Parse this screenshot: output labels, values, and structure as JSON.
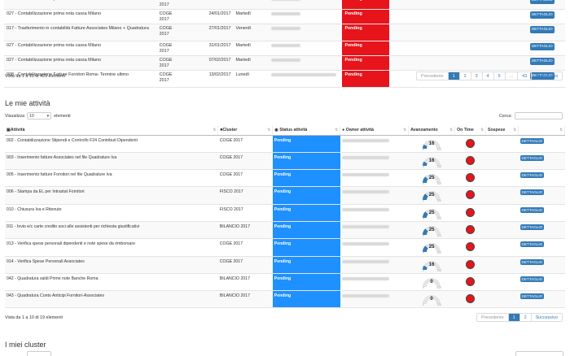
{
  "top_table": {
    "rows": [
      {
        "activity": "027 - Contabilizzazione prima nota cassa Milano",
        "cluster": "COGE 2017",
        "date": "17/01/2017",
        "day": "Martedì",
        "status": "Pending",
        "action": "DETTAGLIO"
      },
      {
        "activity": "027 - Contabilizzazione prima nota cassa Milano",
        "cluster": "COGE 2017",
        "date": "24/01/2017",
        "day": "Martedì",
        "status": "Pending",
        "action": "DETTAGLIO"
      },
      {
        "activity": "017 - Trasferimento in contabilità Fatture Associates Milano + Quadratura",
        "cluster": "COGE 2017",
        "date": "27/01/2017",
        "day": "Venerdì",
        "status": "Pending",
        "action": "DETTAGLIO"
      },
      {
        "activity": "027 - Contabilizzazione prima nota cassa Milano",
        "cluster": "COGE 2017",
        "date": "31/01/2017",
        "day": "Martedì",
        "status": "Pending",
        "action": "DETTAGLIO"
      },
      {
        "activity": "027 - Contabilizzazione prima nota cassa Milano",
        "cluster": "COGE 2017",
        "date": "07/02/2017",
        "day": "Martedì",
        "status": "Pending",
        "action": "DETTAGLIO"
      },
      {
        "activity": "008 - Contabilizzazione Fatture Fornitori Roma- Termine ultimo",
        "cluster": "COGE 2017",
        "date": "13/02/2017",
        "day": "Lunedì",
        "status": "Pending",
        "action": "DETTAGLIO"
      }
    ],
    "info": "Vista da 1 a 10 di 429 elementi",
    "pager": [
      "Precedente",
      "1",
      "2",
      "3",
      "4",
      "5",
      "...",
      "43",
      "Successivo"
    ]
  },
  "activities": {
    "title": "Le mie attività",
    "show_label": "Visualizza",
    "show_value": "10",
    "elements_label": "elementi",
    "search_label": "Cerca:",
    "columns": [
      "Attività",
      "Cluster",
      "Status attività",
      "Owner attività",
      "Avanzamento",
      "On Time",
      "Sospese",
      ""
    ],
    "rows": [
      {
        "activity": "002 - Contabilizzazione Stipendi e Controllo F24 Contributi Dipendenti",
        "cluster": "COGE 2017",
        "status": "Pending",
        "progress": "16",
        "action": "DETTAGLIO"
      },
      {
        "activity": "003 - Inserimento fatture Associates nel file Quadrature Iva",
        "cluster": "COGE 2017",
        "status": "Pending",
        "progress": "16",
        "action": "DETTAGLIO"
      },
      {
        "activity": "005 - Inserimento fatture Fornitori nel file Quadrature Iva",
        "cluster": "COGE 2017",
        "status": "Pending",
        "progress": "25",
        "action": "DETTAGLIO"
      },
      {
        "activity": "006 - Stampa da EL per Intrastat Fornitori",
        "cluster": "FISCO 2017",
        "status": "Pending",
        "progress": "25",
        "action": "DETTAGLIO"
      },
      {
        "activity": "010 - Chiusura Iva e Ritenute",
        "cluster": "FISCO 2017",
        "status": "Pending",
        "progress": "25",
        "action": "DETTAGLIO"
      },
      {
        "activity": "011 - Invio e/c carte credito soci alle assistenti per richiesta giustificativi",
        "cluster": "BILANCIO 2017",
        "status": "Pending",
        "progress": "25",
        "action": "DETTAGLIO"
      },
      {
        "activity": "013 - Verifica spese personali dipendenti e note spese da rimborsare",
        "cluster": "COGE 2017",
        "status": "Pending",
        "progress": "25",
        "action": "DETTAGLIO"
      },
      {
        "activity": "014 - Verifica Spese Personali Associates",
        "cluster": "COGE 2017",
        "status": "Pending",
        "progress": "16",
        "action": "DETTAGLIO"
      },
      {
        "activity": "042 - Quadratura saldi Prime note Banche Roma",
        "cluster": "BILANCIO 2017",
        "status": "Pending",
        "progress": "0",
        "action": "DETTAGLIO"
      },
      {
        "activity": "043 - Quadratura Conto Anticipi Fornitori-Associates",
        "cluster": "BILANCIO 2017",
        "status": "Pending",
        "progress": "0",
        "action": "DETTAGLIO"
      }
    ],
    "info": "Vista da 1 a 10 di 19 elementi",
    "pager": [
      "Precedente",
      "1",
      "2",
      "Successivo"
    ]
  },
  "clusters": {
    "title": "I miei cluster"
  },
  "colors": {
    "pending_top": "#e8141b",
    "pending_activity": "#1e90ff",
    "button": "#337ab7",
    "on_time_dot": "#e8141b"
  }
}
